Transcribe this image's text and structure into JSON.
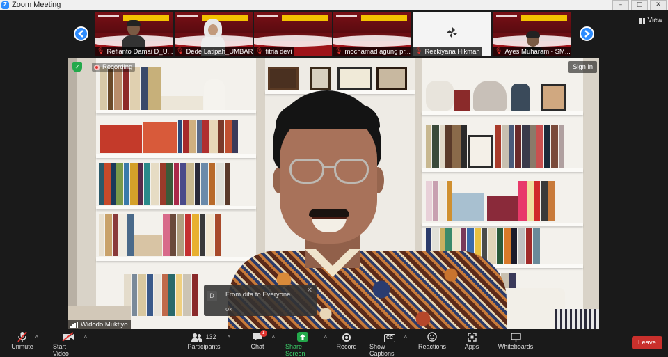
{
  "window": {
    "title": "Zoom Meeting",
    "controls": [
      "–",
      "□",
      "✕"
    ]
  },
  "view_label": "View",
  "gallery": [
    {
      "name": "Refianto Damai D_U...",
      "muted": true
    },
    {
      "name": "Dede Latipah_UMBARA",
      "muted": true
    },
    {
      "name": "fitria devi",
      "muted": true
    },
    {
      "name": "mochamad agung pr...",
      "muted": true
    },
    {
      "name": "Rezkiyana Hikmah",
      "muted": true
    },
    {
      "name": "Ayes Muharam - SM...",
      "muted": true
    }
  ],
  "main": {
    "recording_label": "Recording",
    "signin_label": "Sign in",
    "speaker_name": "Widodo Muktiyo"
  },
  "chat_toast": {
    "avatar_letter": "D",
    "from": "From difa to Everyone",
    "message": "ok"
  },
  "toolbar": {
    "unmute": "Unmute",
    "start_video": "Start Video",
    "participants": "Participants",
    "participants_count": "132",
    "chat": "Chat",
    "chat_badge": "1",
    "share_screen": "Share Screen",
    "record": "Record",
    "captions": "Show Captions",
    "captions_icon": "CC",
    "reactions": "Reactions",
    "apps": "Apps",
    "whiteboards": "Whiteboards",
    "leave": "Leave"
  },
  "colors": {
    "accent": "#2d8cff",
    "share_green": "#23a94b",
    "leave_red": "#c9302c",
    "muted_red": "#e0342f"
  },
  "icons": {
    "unmute": "mic-muted-icon",
    "start_video": "video-off-icon",
    "participants": "participants-icon",
    "chat": "chat-icon",
    "share_screen": "share-screen-icon",
    "record": "record-icon",
    "captions": "captions-icon",
    "reactions": "reactions-icon",
    "apps": "apps-icon",
    "whiteboards": "whiteboard-icon"
  }
}
